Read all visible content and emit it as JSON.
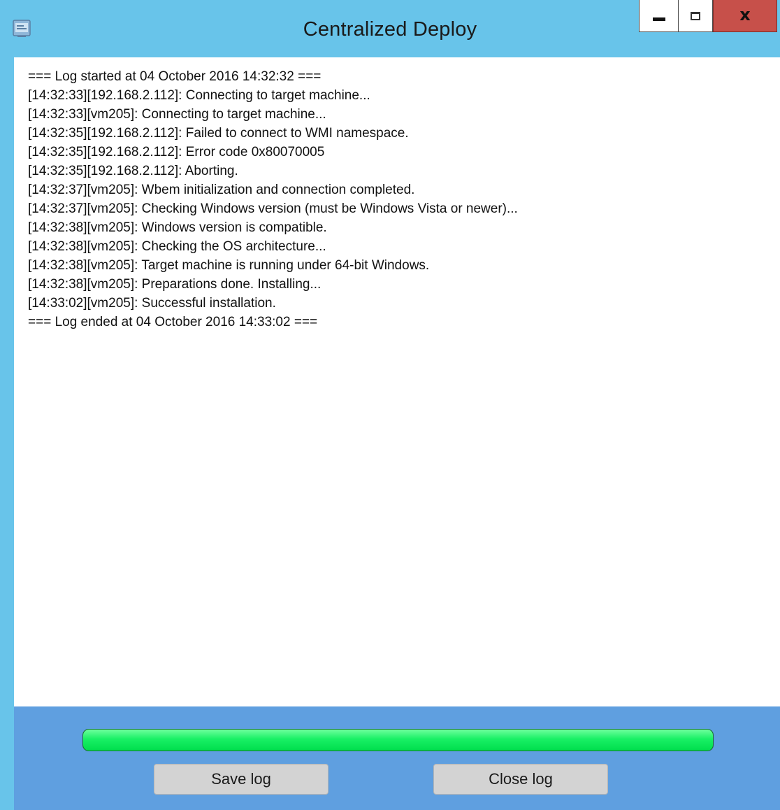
{
  "window": {
    "title": "Centralized Deploy",
    "icon": "app-window-icon",
    "controls": {
      "minimize_icon": "minimize-icon",
      "maximize_icon": "maximize-icon",
      "close_icon": "close-icon",
      "close_glyph": "x"
    }
  },
  "log": {
    "lines": [
      "=== Log started at 04 October 2016 14:32:32 ===",
      "[14:32:33][192.168.2.112]: Connecting to target machine...",
      "[14:32:33][vm205]: Connecting to target machine...",
      "[14:32:35][192.168.2.112]: Failed to connect to WMI namespace.",
      "[14:32:35][192.168.2.112]: Error code 0x80070005",
      "[14:32:35][192.168.2.112]: Aborting.",
      "[14:32:37][vm205]: Wbem initialization and connection completed.",
      "[14:32:37][vm205]: Checking Windows version (must be Windows Vista or newer)...",
      "[14:32:38][vm205]: Windows version is compatible.",
      "[14:32:38][vm205]: Checking the OS architecture...",
      "[14:32:38][vm205]: Target machine is running under 64-bit Windows.",
      "[14:32:38][vm205]: Preparations done. Installing...",
      "[14:33:02][vm205]: Successful installation.",
      "=== Log ended at 04 October 2016 14:33:02 ==="
    ]
  },
  "progress": {
    "percent": 100
  },
  "buttons": {
    "save_label": "Save log",
    "close_label": "Close log"
  },
  "colors": {
    "titlebar": "#68c4ea",
    "footer": "#5f9fe0",
    "progress_fill": "#19f065",
    "close_button": "#c7504a",
    "button_face": "#d3d3d3"
  }
}
